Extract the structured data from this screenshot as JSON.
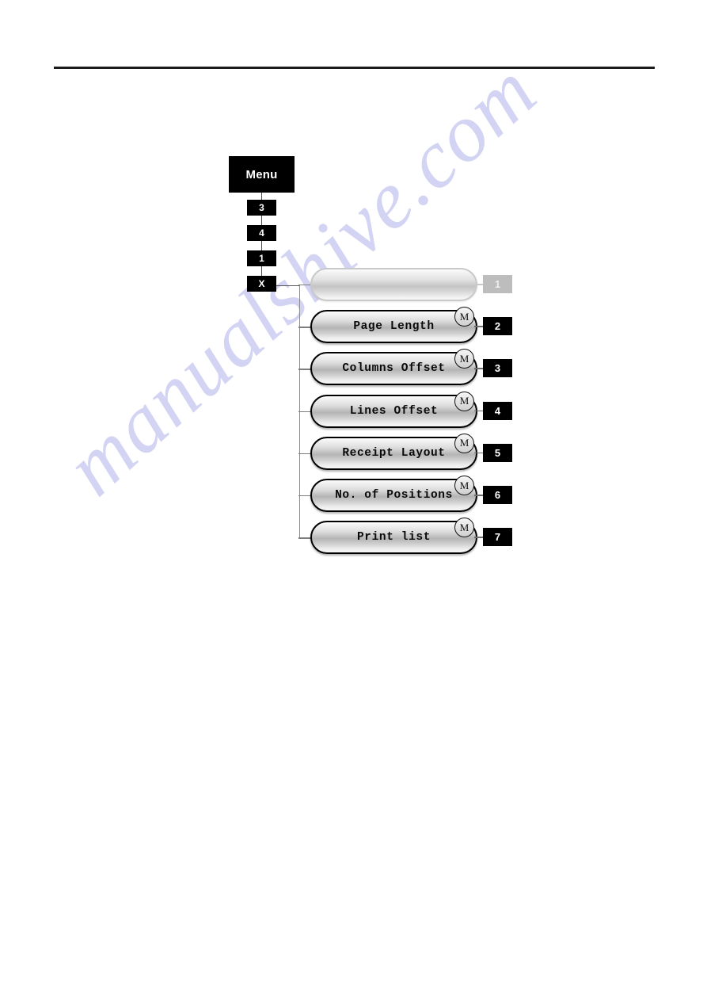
{
  "document": {
    "has_top_rule": true,
    "watermark_text": "manualshive.com",
    "background_color": "#ffffff"
  },
  "key_sequence": {
    "name": "menu-key-path",
    "entry_label": "Menu",
    "keys": [
      {
        "label": "3"
      },
      {
        "label": "4"
      },
      {
        "label": "1"
      },
      {
        "label": "X"
      }
    ]
  },
  "menu": {
    "title": "",
    "accent_black": "#000000",
    "accent_muted": "#bdbdbd",
    "items": [
      {
        "label": "",
        "badge": "1",
        "badge_style": "muted",
        "has_m_badge": false,
        "is_ghost": true
      },
      {
        "label": "Page Length",
        "badge": "2",
        "badge_style": "solid",
        "has_m_badge": true,
        "is_ghost": false
      },
      {
        "label": "Columns Offset",
        "badge": "3",
        "badge_style": "solid",
        "has_m_badge": true,
        "is_ghost": false
      },
      {
        "label": "Lines Offset",
        "badge": "4",
        "badge_style": "solid",
        "has_m_badge": true,
        "is_ghost": false
      },
      {
        "label": "Receipt Layout",
        "badge": "5",
        "badge_style": "solid",
        "has_m_badge": true,
        "is_ghost": false
      },
      {
        "label": "No. of Positions",
        "badge": "6",
        "badge_style": "solid",
        "has_m_badge": true,
        "is_ghost": false
      },
      {
        "label": "Print list",
        "badge": "7",
        "badge_style": "solid",
        "has_m_badge": true,
        "is_ghost": false
      }
    ],
    "m_badge_label": "M"
  }
}
